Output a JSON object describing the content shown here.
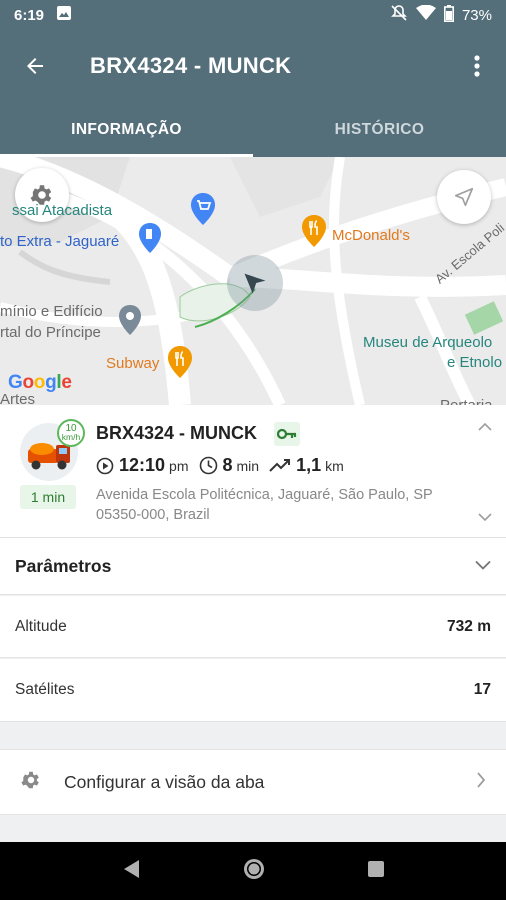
{
  "status_bar": {
    "time": "6:19",
    "battery": "73%"
  },
  "app_bar": {
    "title": "BRX4324 - MUNCK"
  },
  "tabs": [
    {
      "label": "INFORMAÇÃO",
      "active": true
    },
    {
      "label": "HISTÓRICO",
      "active": false
    }
  ],
  "map": {
    "labels": {
      "assai": "ssai Atacadista",
      "extra": "to Extra - Jaguaré",
      "mcdonalds": "McDonald's",
      "condominio_1": "mínio e Edifício",
      "condominio_2": "rtal do Príncipe",
      "subway": "Subway",
      "road": "Av. Escola Poli",
      "museu_1": "Museu de Arqueolo",
      "museu_2": "e Etnolo",
      "artes": "Artes",
      "portaria": "Portaria"
    },
    "google": "Google"
  },
  "vehicle": {
    "name": "BRX4324 - MUNCK",
    "speed_value": "10",
    "speed_unit": "km/h",
    "duration": "1 min",
    "time": "12:10",
    "time_suffix": "pm",
    "elapsed": "8",
    "elapsed_unit": "min",
    "distance": "1,1",
    "distance_unit": "km",
    "address": "Avenida Escola Politécnica, Jaguaré, São Paulo, SP 05350-000, Brazil"
  },
  "parameters": {
    "label": "Parâmetros",
    "rows": [
      {
        "key": "Altitude",
        "value": "732 m"
      },
      {
        "key": "Satélites",
        "value": "17"
      }
    ]
  },
  "config": {
    "label": "Configurar a visão da aba"
  },
  "colors": {
    "primary": "#546e7a",
    "accent_green": "#2e7d32",
    "map_bg": "#ebebeb"
  }
}
